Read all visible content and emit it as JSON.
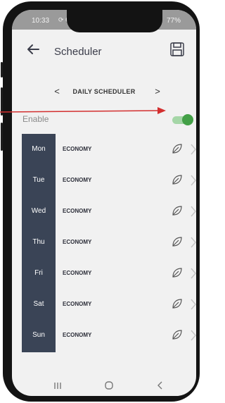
{
  "status_bar": {
    "time": "10:33",
    "battery": "77%",
    "icons": [
      "sync-icon",
      "gear-icon",
      "b-icon",
      "b-icon"
    ]
  },
  "header": {
    "title": "Scheduler"
  },
  "scheduler_nav": {
    "label": "DAILY SCHEDULER",
    "prev": "<",
    "next": ">"
  },
  "enable": {
    "label": "Enable",
    "on": true
  },
  "days": [
    {
      "day": "Mon",
      "mode": "ECONOMY"
    },
    {
      "day": "Tue",
      "mode": "ECONOMY"
    },
    {
      "day": "Wed",
      "mode": "ECONOMY"
    },
    {
      "day": "Thu",
      "mode": "ECONOMY"
    },
    {
      "day": "Fri",
      "mode": "ECONOMY"
    },
    {
      "day": "Sat",
      "mode": "ECONOMY"
    },
    {
      "day": "Sun",
      "mode": "ECONOMY"
    }
  ],
  "colors": {
    "day_column": "#3a4456",
    "toggle_on": "#43a047",
    "annotation_arrow": "#d32f2f"
  }
}
